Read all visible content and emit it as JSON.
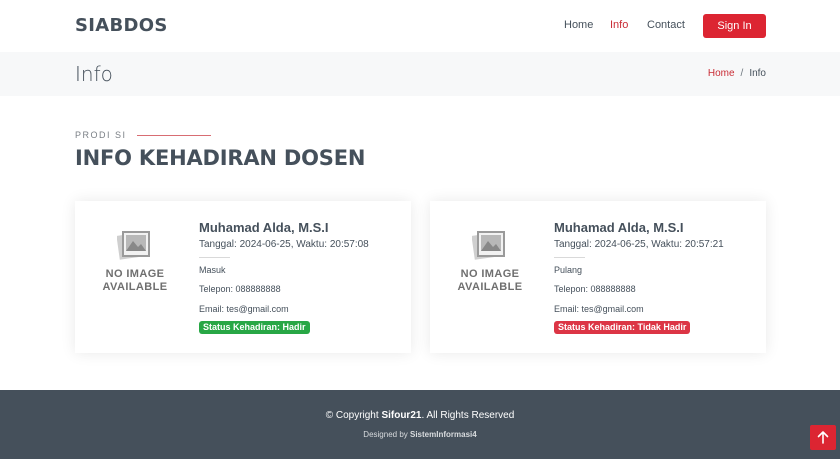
{
  "brand": "SIABDOS",
  "nav": {
    "home": "Home",
    "info": "Info",
    "contact": "Contact",
    "signin": "Sign In"
  },
  "breadcrumb": {
    "title": "Info",
    "home": "Home",
    "separator": "/",
    "current": "Info"
  },
  "section": {
    "subtitle": "PRODI SI",
    "title": "INFO KEHADIRAN DOSEN"
  },
  "cards": [
    {
      "image_placeholder": "NO IMAGE AVAILABLE",
      "name": "Muhamad Alda, M.S.I",
      "datetime": "Tanggal: 2024-06-25, Waktu: 20:57:08",
      "type": "Masuk",
      "phone": "Telepon: 088888888",
      "email": "Email: tes@gmail.com",
      "status": "Status Kehadiran: Hadir",
      "status_color": "#28a745"
    },
    {
      "image_placeholder": "NO IMAGE AVAILABLE",
      "name": "Muhamad Alda, M.S.I",
      "datetime": "Tanggal: 2024-06-25, Waktu: 20:57:21",
      "type": "Pulang",
      "phone": "Telepon: 088888888",
      "email": "Email: tes@gmail.com",
      "status": "Status Kehadiran: Tidak Hadir",
      "status_color": "#dc3545"
    }
  ],
  "footer": {
    "copyright_prefix": "© Copyright ",
    "copyright_brand": "Sifour21",
    "copyright_suffix": ". All Rights Reserved",
    "credits_prefix": "Designed by ",
    "credits_brand": "SistemInformasi4"
  },
  "colors": {
    "accent": "#dc2532",
    "dark": "#45505b",
    "success": "#28a745",
    "danger": "#dc3545"
  },
  "icons": {
    "back_to_top": "arrow-up-icon",
    "placeholder": "image-placeholder-icon"
  }
}
